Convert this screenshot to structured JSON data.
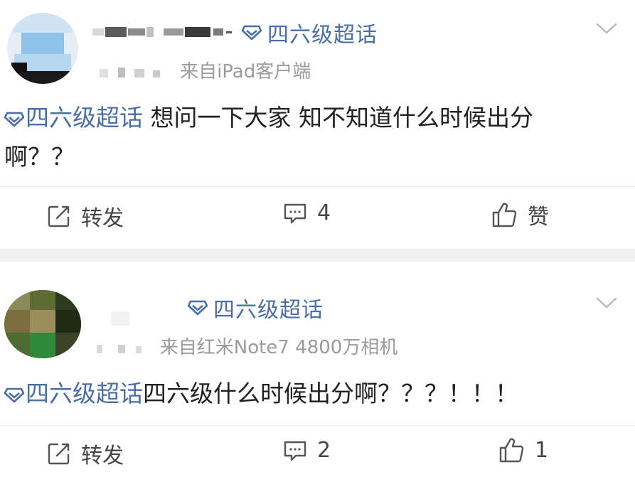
{
  "posts": [
    {
      "supertopic": "四六级超话",
      "source": "来自iPad客户端",
      "topic_tag": "四六级超话",
      "content_text": " 想问一下大家 知不知道什么时候出分",
      "content_text_2": "啊？？",
      "actions": {
        "repost": "转发",
        "comments": "4",
        "like": "赞"
      }
    },
    {
      "supertopic": "四六级超话",
      "source": "来自红米Note7 4800万相机",
      "topic_tag": "四六级超话",
      "content_text": "四六级什么时候出分啊？？？！！！",
      "actions": {
        "repost": "转发",
        "comments": "2",
        "like": "1"
      }
    }
  ],
  "icons": {
    "supertopic": "diamond-icon",
    "more": "chevron-down-icon",
    "repost": "repost-icon",
    "comment": "comment-icon",
    "like": "thumbs-up-icon"
  },
  "colors": {
    "link": "#4a6fa5",
    "text": "#222222",
    "meta": "#9b9b9b",
    "separator": "#f0f0f0",
    "status_dot": "#3cb34a"
  }
}
